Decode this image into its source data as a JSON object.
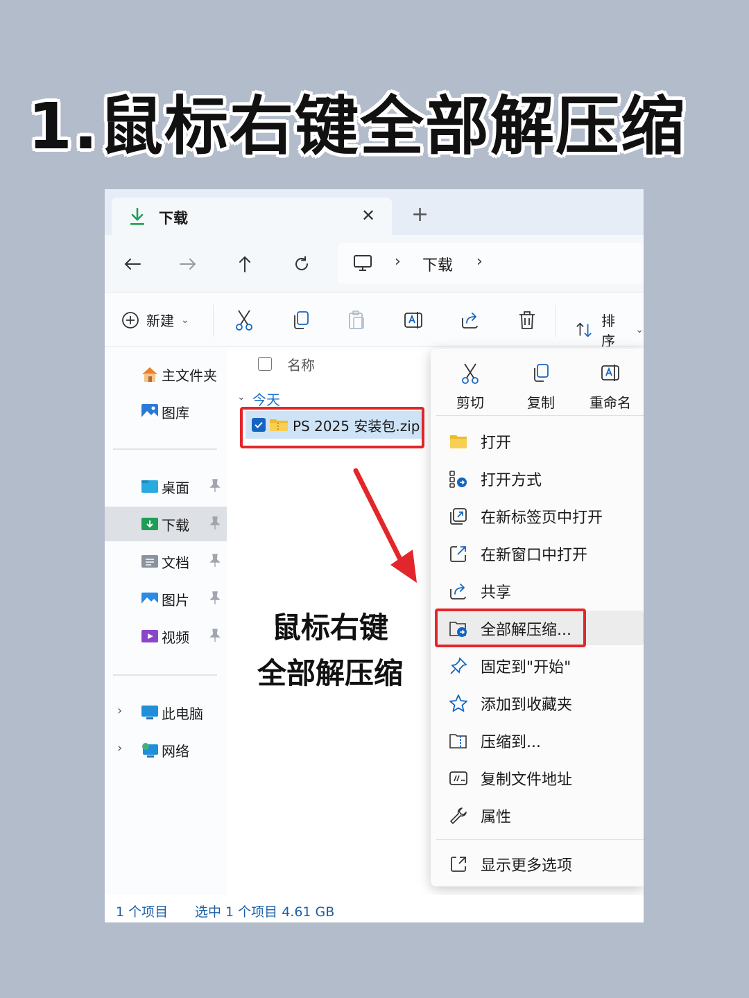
{
  "headline": "1.鼠标右键全部解压缩",
  "tab": {
    "title": "下载",
    "close": "✕",
    "new_tab": "+"
  },
  "nav": {
    "back": "←",
    "forward": "→",
    "up": "↑",
    "refresh": "↻"
  },
  "address": {
    "sep": "›",
    "location": "下载"
  },
  "toolbar": {
    "new_label": "新建",
    "new_chevron": "⌄",
    "sort_label": "排序",
    "sort_chevron": "⌄"
  },
  "sidebar": {
    "home": "主文件夹",
    "gallery": "图库",
    "desktop": "桌面",
    "downloads": "下载",
    "documents": "文档",
    "pictures": "图片",
    "videos": "视频",
    "this_pc": "此电脑",
    "network": "网络",
    "chevron": "›"
  },
  "content": {
    "column_name": "名称",
    "group_label": "今天",
    "group_chevron": "⌄",
    "file_name": "PS 2025 安装包.zip"
  },
  "note": {
    "line1": "鼠标右键",
    "line2": "全部解压缩"
  },
  "status": {
    "count": "1 个项目",
    "selected": "选中 1 个项目  4.61 GB"
  },
  "context_menu": {
    "cut": "剪切",
    "copy": "复制",
    "rename": "重命名",
    "items": [
      "打开",
      "打开方式",
      "在新标签页中打开",
      "在新窗口中打开",
      "共享",
      "全部解压缩...",
      "固定到\"开始\"",
      "添加到收藏夹",
      "压缩到...",
      "复制文件地址",
      "属性"
    ],
    "more": "显示更多选项"
  },
  "colors": {
    "highlight_red": "#e3262b",
    "accent_blue": "#1565c0",
    "folder_yellow": "#f2b928"
  }
}
